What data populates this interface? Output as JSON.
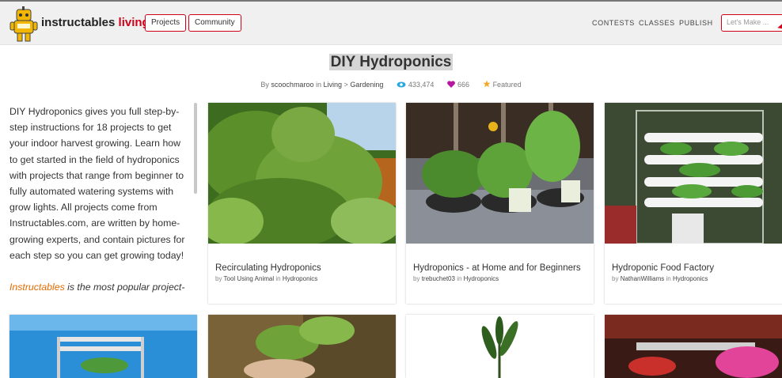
{
  "header": {
    "brand_main": "instructables",
    "brand_accent": "living",
    "projects_label": "Projects",
    "community_label": "Community",
    "nav": [
      "CONTESTS",
      "CLASSES",
      "PUBLISH"
    ],
    "search_placeholder": "Let's Make ..."
  },
  "page": {
    "title": "DIY Hydroponics",
    "by": "By",
    "author": "scoochmaroo",
    "in": "in",
    "category": "Living",
    "sep": ">",
    "subcategory": "Gardening",
    "views": "433,474",
    "favorites": "666",
    "featured": "Featured"
  },
  "description": {
    "paragraph1": "DIY Hydroponics gives you full step-by-step instructions for 18 projects to get your indoor harvest growing. Learn how to get started in the field of hydroponics with projects that range from beginner to fully automated watering systems with grow lights. All projects come from Instructables.com, are written by home-growing experts, and contain pictures for each step so you can get growing today!",
    "link_text": "Instructables",
    "paragraph2_rest": " is the most popular project-"
  },
  "cards": [
    {
      "title": "Recirculating Hydroponics",
      "by": "by",
      "author": "Tool Using Animal",
      "in": "in",
      "category": "Hydroponics"
    },
    {
      "title": "Hydroponics - at Home and for Beginners",
      "by": "by",
      "author": "trebuchet03",
      "in": "in",
      "category": "Hydroponics"
    },
    {
      "title": "Hydroponic Food Factory",
      "by": "by",
      "author": "NathanWilliams",
      "in": "in",
      "category": "Hydroponics"
    }
  ],
  "colors": {
    "accent": "#d0021b",
    "link": "#e46b00",
    "eye": "#2aa7e0",
    "heart": "#b5179e",
    "star": "#f5a623"
  }
}
